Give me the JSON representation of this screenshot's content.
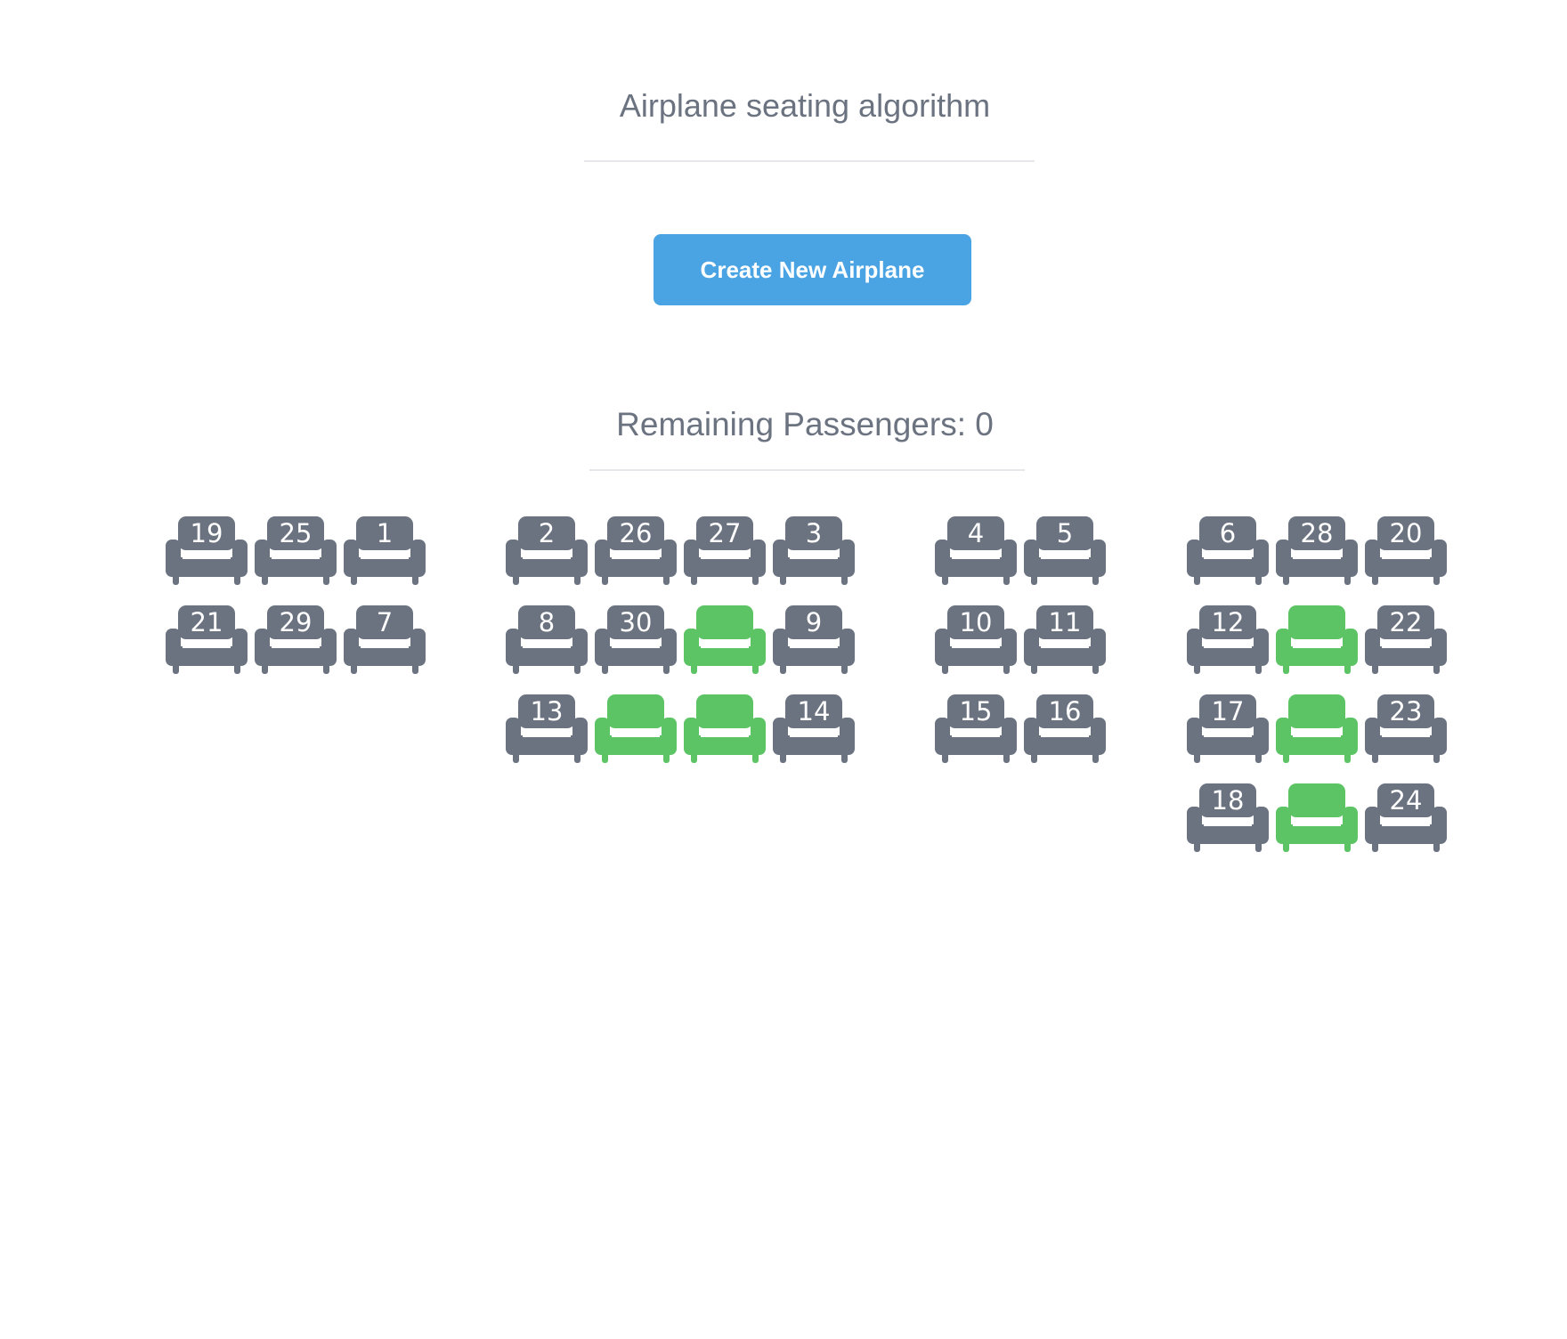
{
  "title": "Airplane seating algorithm",
  "create_button_label": "Create New Airplane",
  "remaining_passengers_text": "Remaining Passengers: 0",
  "colors": {
    "occupied": "#6b7280",
    "free": "#5cc465",
    "button": "#4aa3e3"
  },
  "seat_icon": "armchair-icon",
  "sections": [
    {
      "rows": [
        [
          {
            "label": "19"
          },
          {
            "label": "25"
          },
          {
            "label": "1"
          }
        ],
        [
          {
            "label": "21"
          },
          {
            "label": "29"
          },
          {
            "label": "7"
          }
        ]
      ]
    },
    {
      "rows": [
        [
          {
            "label": "2"
          },
          {
            "label": "26"
          },
          {
            "label": "27"
          },
          {
            "label": "3"
          }
        ],
        [
          {
            "label": "8"
          },
          {
            "label": "30"
          },
          {
            "label": ""
          },
          {
            "label": "9"
          }
        ],
        [
          {
            "label": "13"
          },
          {
            "label": ""
          },
          {
            "label": ""
          },
          {
            "label": "14"
          }
        ]
      ]
    },
    {
      "rows": [
        [
          {
            "label": "4"
          },
          {
            "label": "5"
          }
        ],
        [
          {
            "label": "10"
          },
          {
            "label": "11"
          }
        ],
        [
          {
            "label": "15"
          },
          {
            "label": "16"
          }
        ]
      ]
    },
    {
      "rows": [
        [
          {
            "label": "6"
          },
          {
            "label": "28"
          },
          {
            "label": "20"
          }
        ],
        [
          {
            "label": "12"
          },
          {
            "label": ""
          },
          {
            "label": "22"
          }
        ],
        [
          {
            "label": "17"
          },
          {
            "label": ""
          },
          {
            "label": "23"
          }
        ],
        [
          {
            "label": "18"
          },
          {
            "label": ""
          },
          {
            "label": "24"
          }
        ]
      ]
    }
  ]
}
